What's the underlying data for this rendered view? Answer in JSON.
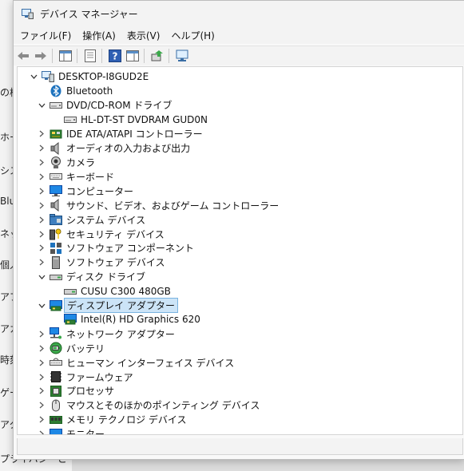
{
  "window": {
    "title": "デバイス マネージャー"
  },
  "menu": [
    {
      "label": "ファイル(F)"
    },
    {
      "label": "操作(A)"
    },
    {
      "label": "表示(V)"
    },
    {
      "label": "ヘルプ(H)"
    }
  ],
  "background_fragments": [
    "の検",
    "ホー",
    "シス",
    "Blu",
    "ネッ",
    "個人",
    "アプ",
    "アカ",
    "時刻",
    "ゲー",
    "アク",
    "プライバシーとセ"
  ],
  "tree": {
    "root": "DESKTOP-I8GUD2E",
    "items": [
      {
        "label": "Bluetooth",
        "level": 1,
        "chevron": "none",
        "icon": "bluetooth-icon"
      },
      {
        "label": "DVD/CD-ROM ドライブ",
        "level": 1,
        "chevron": "expanded",
        "icon": "dvd-drive-icon"
      },
      {
        "label": "HL-DT-ST DVDRAM GUD0N",
        "level": 2,
        "chevron": "none",
        "icon": "dvd-drive-icon"
      },
      {
        "label": "IDE ATA/ATAPI コントローラー",
        "level": 1,
        "chevron": "collapsed",
        "icon": "ide-controller-icon"
      },
      {
        "label": "オーディオの入力および出力",
        "level": 1,
        "chevron": "collapsed",
        "icon": "speaker-icon"
      },
      {
        "label": "カメラ",
        "level": 1,
        "chevron": "collapsed",
        "icon": "camera-icon"
      },
      {
        "label": "キーボード",
        "level": 1,
        "chevron": "collapsed",
        "icon": "keyboard-icon"
      },
      {
        "label": "コンピューター",
        "level": 1,
        "chevron": "collapsed",
        "icon": "monitor-icon"
      },
      {
        "label": "サウンド、ビデオ、およびゲーム コントローラー",
        "level": 1,
        "chevron": "collapsed",
        "icon": "speaker-icon"
      },
      {
        "label": "システム デバイス",
        "level": 1,
        "chevron": "collapsed",
        "icon": "system-folder-icon"
      },
      {
        "label": "セキュリティ デバイス",
        "level": 1,
        "chevron": "collapsed",
        "icon": "key-icon"
      },
      {
        "label": "ソフトウェア コンポーネント",
        "level": 1,
        "chevron": "collapsed",
        "icon": "component-icon"
      },
      {
        "label": "ソフトウェア デバイス",
        "level": 1,
        "chevron": "collapsed",
        "icon": "tower-icon"
      },
      {
        "label": "ディスク ドライブ",
        "level": 1,
        "chevron": "expanded",
        "icon": "disk-drive-icon"
      },
      {
        "label": "CUSU C300 480GB",
        "level": 2,
        "chevron": "none",
        "icon": "disk-drive-icon"
      },
      {
        "label": "ディスプレイ アダプター",
        "level": 1,
        "chevron": "expanded",
        "icon": "display-adapter-icon",
        "selected": true
      },
      {
        "label": "Intel(R) HD Graphics 620",
        "level": 2,
        "chevron": "none",
        "icon": "display-adapter-icon"
      },
      {
        "label": "ネットワーク アダプター",
        "level": 1,
        "chevron": "collapsed",
        "icon": "network-icon"
      },
      {
        "label": "バッテリ",
        "level": 1,
        "chevron": "collapsed",
        "icon": "battery-icon"
      },
      {
        "label": "ヒューマン インターフェイス デバイス",
        "level": 1,
        "chevron": "collapsed",
        "icon": "hid-icon"
      },
      {
        "label": "ファームウェア",
        "level": 1,
        "chevron": "collapsed",
        "icon": "firmware-icon"
      },
      {
        "label": "プロセッサ",
        "level": 1,
        "chevron": "collapsed",
        "icon": "processor-icon"
      },
      {
        "label": "マウスとそのほかのポインティング デバイス",
        "level": 1,
        "chevron": "collapsed",
        "icon": "mouse-icon"
      },
      {
        "label": "メモリ テクノロジ デバイス",
        "level": 1,
        "chevron": "collapsed",
        "icon": "memory-icon"
      },
      {
        "label": "モニター",
        "level": 1,
        "chevron": "collapsed",
        "icon": "monitor-icon"
      }
    ]
  },
  "colors": {
    "selection_bg": "#cce4f7",
    "selection_border": "#7ab3e0",
    "accent": "#1e73be"
  }
}
